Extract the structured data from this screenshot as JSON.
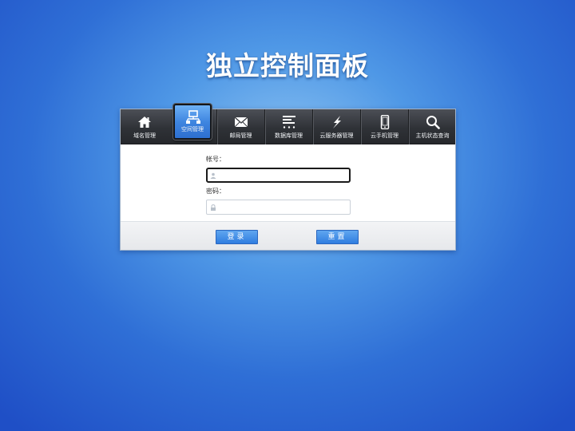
{
  "page": {
    "title": "独立控制面板"
  },
  "nav": {
    "items": [
      {
        "label": "域名管理",
        "icon": "home-icon"
      },
      {
        "label": "空间管理",
        "icon": "network-icon",
        "active": true
      },
      {
        "label": "邮局管理",
        "icon": "mail-icon"
      },
      {
        "label": "数据库管理",
        "icon": "database-list-icon"
      },
      {
        "label": "云服务器管理",
        "icon": "lightning-icon"
      },
      {
        "label": "云手机管理",
        "icon": "phone-icon"
      },
      {
        "label": "主机状态查询",
        "icon": "search-icon"
      }
    ]
  },
  "login": {
    "account_label": "帐号：",
    "account_value": "",
    "password_label": "密码：",
    "password_value": "",
    "submit_label": "登录",
    "reset_label": "重置"
  },
  "colors": {
    "accent": "#3f86e0",
    "navbar": "#2f3237",
    "background": "#2f6fd6"
  }
}
